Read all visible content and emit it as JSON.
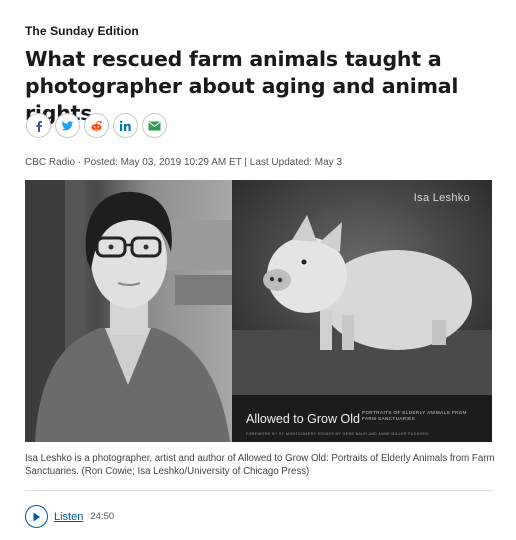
{
  "article": {
    "show": "The Sunday Edition",
    "headline": "What rescued farm animals taught a photographer about aging and animal rights",
    "byline": "CBC Radio · Posted: May 03, 2019 10:29 AM ET | Last Updated: May 3",
    "caption": "Isa Leshko is a photographer, artist and author of Allowed to Grow Old: Portraits of Elderly Animals from Farm Sanctuaries. (Ron Cowie; Isa Leshko/University of Chicago Press)"
  },
  "share": {
    "buttons": [
      "facebook-icon",
      "twitter-icon",
      "reddit-icon",
      "linkedin-icon",
      "email-icon"
    ],
    "colors": {
      "facebook": "#3b5998",
      "twitter": "#1da1f2",
      "reddit": "#ff4500",
      "linkedin": "#0077b5",
      "email": "#2e9d4d"
    }
  },
  "image": {
    "book_author": "Isa Leshko",
    "book_title": "Allowed to Grow Old",
    "book_subtitle": "PORTRAITS OF ELDERLY ANIMALS FROM FARM SANCTUARIES",
    "book_foreword": "FOREWORD BY SY MONTGOMERY   ESSAYS BY GENE BAUR AND ANNE MILLER FUCHSEN"
  },
  "audio": {
    "label": "Listen",
    "duration": "24:50",
    "accent": "#0059a8"
  }
}
